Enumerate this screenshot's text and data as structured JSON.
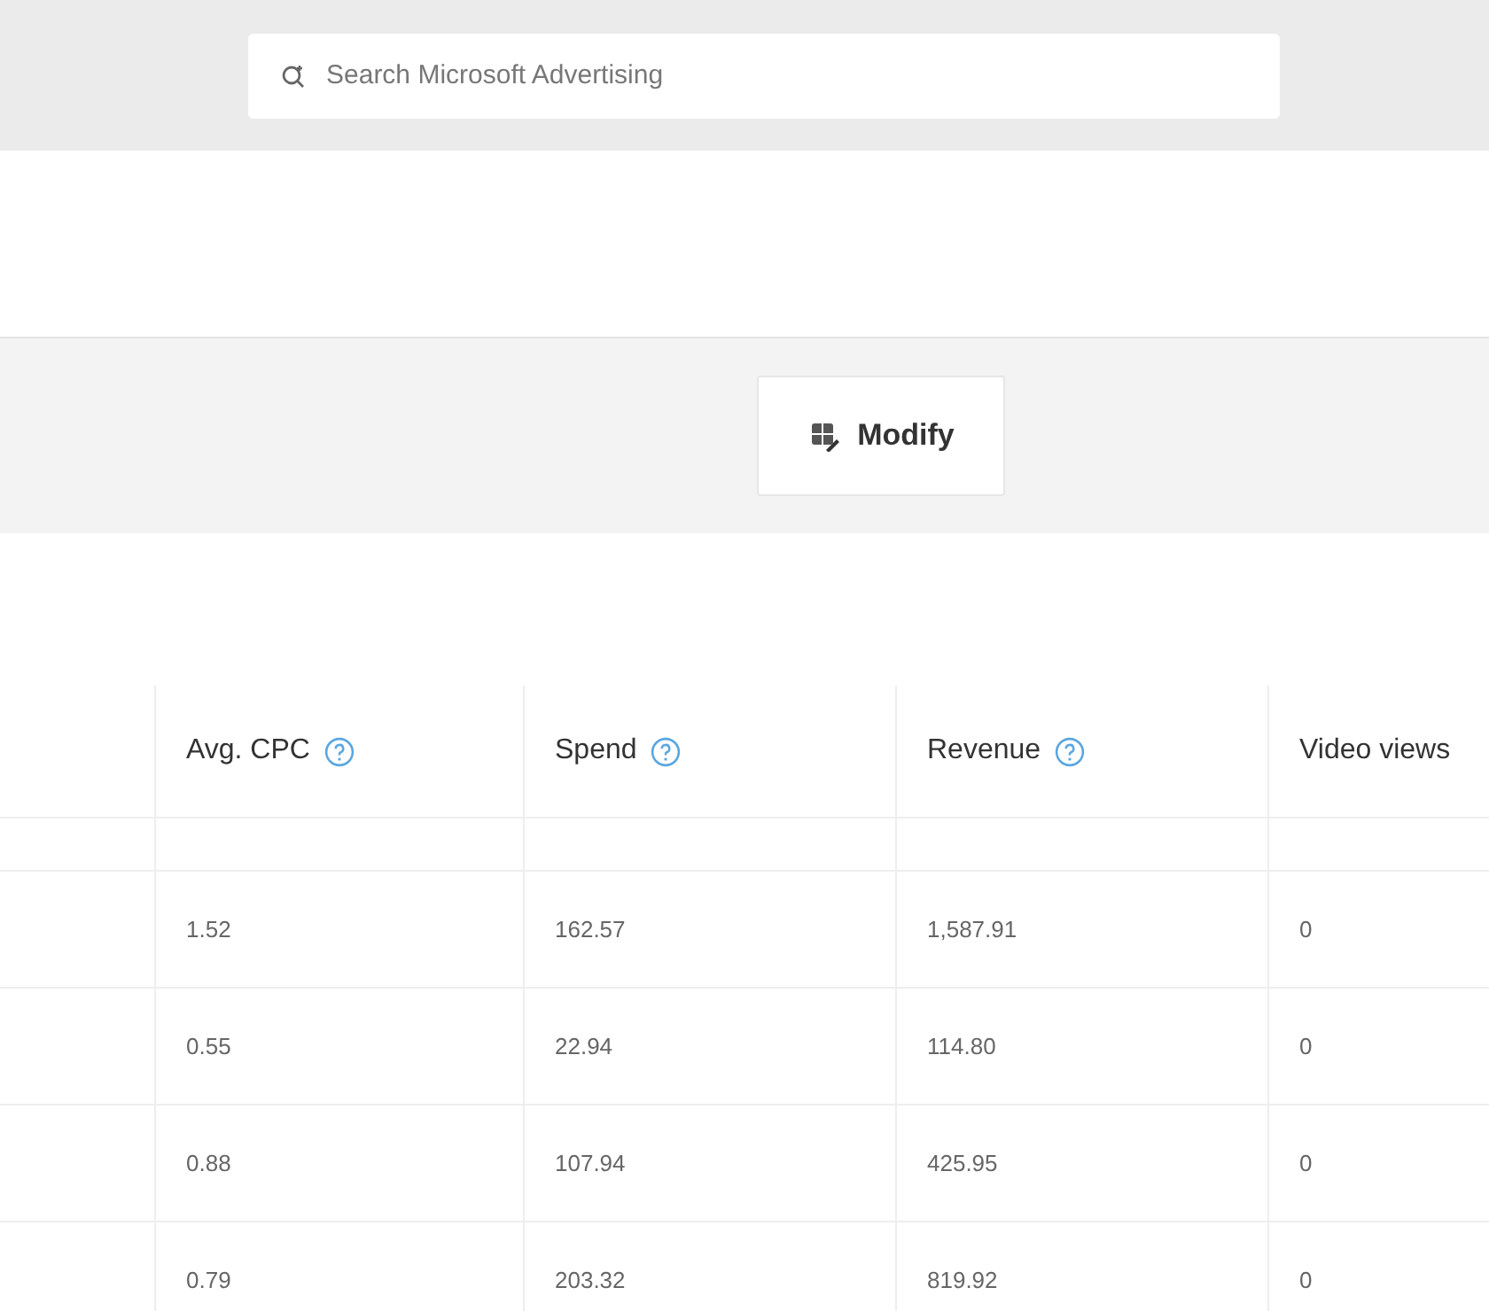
{
  "search": {
    "placeholder": "Search Microsoft Advertising"
  },
  "toolbar": {
    "modify_button": "Modify"
  },
  "table": {
    "columns": [
      {
        "label": "Avg. CPC",
        "help": true
      },
      {
        "label": "Spend",
        "help": true
      },
      {
        "label": "Revenue",
        "help": true
      },
      {
        "label": "Video views",
        "help": false
      }
    ],
    "rows": [
      [
        "1.52",
        "162.57",
        "1,587.91",
        "0"
      ],
      [
        "0.55",
        "22.94",
        "114.80",
        "0"
      ],
      [
        "0.88",
        "107.94",
        "425.95",
        "0"
      ],
      [
        "0.79",
        "203.32",
        "819.92",
        "0"
      ]
    ]
  }
}
